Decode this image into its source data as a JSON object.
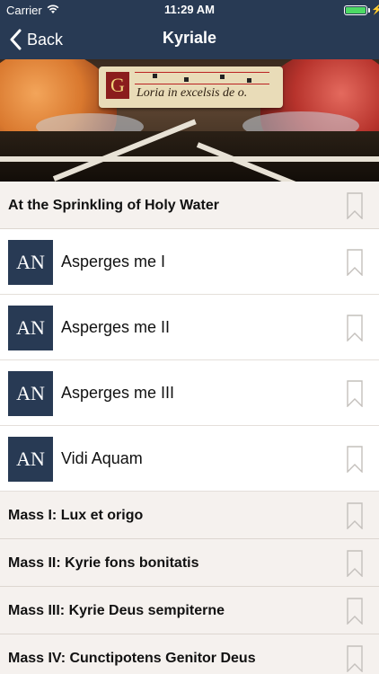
{
  "status_bar": {
    "carrier": "Carrier",
    "time": "11:29 AM",
    "charging_glyph": "⚡",
    "battery_level": 1.0,
    "battery_color": "#4cd964"
  },
  "nav": {
    "back_label": "Back",
    "title": "Kyriale",
    "background": "#283a54"
  },
  "banner": {
    "initial": "G",
    "scroll_text": "Loria in excelsis de o."
  },
  "list": {
    "sections_and_rows": [
      {
        "kind": "section",
        "title": "At the Sprinkling of Holy Water"
      },
      {
        "kind": "row",
        "badge": "AN",
        "title": "Asperges me I"
      },
      {
        "kind": "row",
        "badge": "AN",
        "title": "Asperges me II"
      },
      {
        "kind": "row",
        "badge": "AN",
        "title": "Asperges me III"
      },
      {
        "kind": "row",
        "badge": "AN",
        "title": "Vidi Aquam"
      },
      {
        "kind": "section",
        "title": "Mass I: Lux et origo"
      },
      {
        "kind": "section",
        "title": "Mass II: Kyrie fons bonitatis"
      },
      {
        "kind": "section",
        "title": "Mass III: Kyrie Deus sempiterne"
      },
      {
        "kind": "section",
        "title": "Mass IV: Cunctipotens Genitor Deus"
      }
    ],
    "bookmark_icon": "bookmark-outline-icon"
  }
}
